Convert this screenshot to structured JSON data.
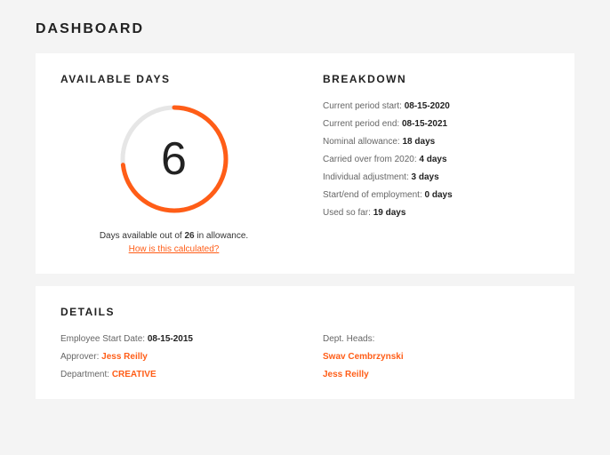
{
  "page_title": "DASHBOARD",
  "available": {
    "title": "AVAILABLE DAYS",
    "number": "6",
    "text_prefix": "Days available out of ",
    "allowance_total": "26",
    "text_suffix": " in allowance.",
    "calc_link": "How is this calculated?"
  },
  "breakdown": {
    "title": "BREAKDOWN",
    "items": [
      {
        "label": "Current period start:",
        "value": "08-15-2020"
      },
      {
        "label": "Current period end:",
        "value": "08-15-2021"
      },
      {
        "label": "Nominal allowance:",
        "value": "18 days"
      },
      {
        "label": "Carried over from 2020:",
        "value": "4 days"
      },
      {
        "label": "Individual adjustment:",
        "value": "3 days"
      },
      {
        "label": "Start/end of employment:",
        "value": "0 days"
      },
      {
        "label": "Used so far:",
        "value": "19 days"
      }
    ]
  },
  "details": {
    "title": "DETAILS",
    "left": [
      {
        "label": "Employee Start Date:",
        "value": "08-15-2015",
        "style": "bold"
      },
      {
        "label": "Approver:",
        "value": "Jess Reilly",
        "style": "orange"
      },
      {
        "label": "Department:",
        "value": "CREATIVE",
        "style": "orange"
      }
    ],
    "right": [
      {
        "label": "Dept. Heads:",
        "value": "",
        "style": "plain"
      },
      {
        "label": "",
        "value": "Swav Cembrzynski",
        "style": "orange"
      },
      {
        "label": "",
        "value": "Jess Reilly",
        "style": "orange"
      }
    ]
  },
  "chart_data": {
    "type": "pie",
    "title": "Available Days",
    "values": [
      19,
      6
    ],
    "series": [
      {
        "name": "Used",
        "value": 19
      },
      {
        "name": "Available",
        "value": 6
      }
    ],
    "total": 26,
    "colors": {
      "used": "#ff5d17",
      "available": "#e6e6e6"
    }
  }
}
